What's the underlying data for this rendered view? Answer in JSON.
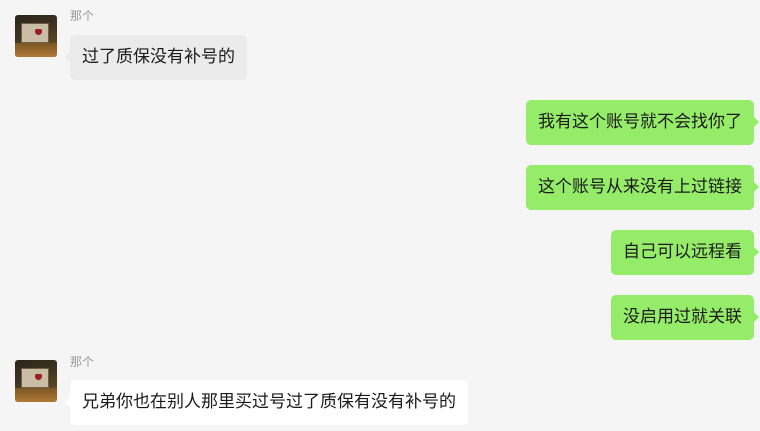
{
  "messages": [
    {
      "sender": "那个",
      "direction": "incoming",
      "text": "过了质保没有补号的"
    },
    {
      "direction": "outgoing",
      "text": "我有这个账号就不会找你了"
    },
    {
      "direction": "outgoing",
      "text": "这个账号从来没有上过链接"
    },
    {
      "direction": "outgoing",
      "text": "自己可以远程看"
    },
    {
      "direction": "outgoing",
      "text": "没启用过就关联"
    },
    {
      "sender": "那个",
      "direction": "incoming",
      "text": "兄弟你也在别人那里买过号过了质保有没有补号的"
    }
  ],
  "colors": {
    "background": "#f5f5f5",
    "incoming_bubble": "#ebebeb",
    "incoming_bubble_last": "#ffffff",
    "outgoing_bubble": "#95ec69",
    "sender_name": "#9a9a9a"
  }
}
